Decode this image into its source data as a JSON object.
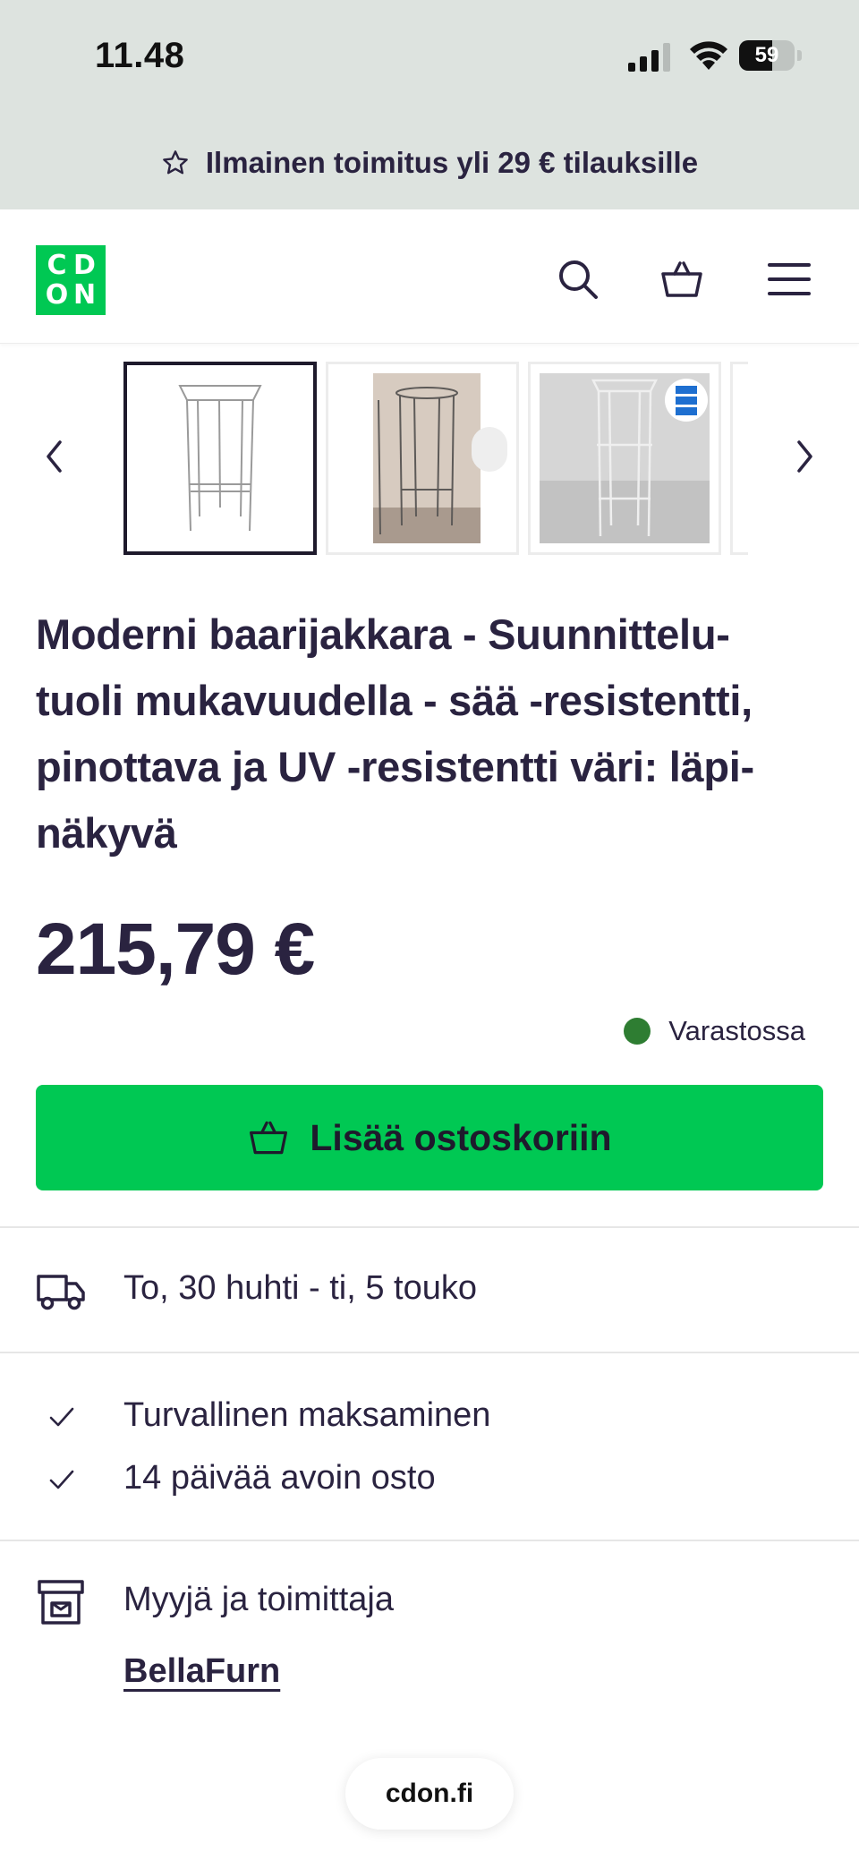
{
  "status_bar": {
    "time": "11.48",
    "battery_percent": "59",
    "battery_level": 0.59
  },
  "promo": {
    "text": "Ilmainen toimitus yli 29 € tilauksille",
    "icon": "star-outline-icon"
  },
  "header": {
    "logo_letters": [
      "C",
      "D",
      "O",
      "N"
    ],
    "logo_color": "#00c853",
    "icons": [
      "search-icon",
      "basket-icon",
      "menu-icon"
    ]
  },
  "gallery": {
    "thumbnails": [
      {
        "name": "thumbnail-1",
        "active": true
      },
      {
        "name": "thumbnail-2",
        "active": false
      },
      {
        "name": "thumbnail-3",
        "active": false
      }
    ],
    "prev_icon": "chevron-left-icon",
    "next_icon": "chevron-right-icon"
  },
  "product": {
    "title_lines": [
      "Moderni baarijakkara - Suunnittelu-",
      "tuoli mukavuudella - sää -resistentti,",
      "pinottava ja UV -resistentti väri: läpi-",
      "näkyvä"
    ],
    "price": "215,79 €",
    "stock_label": "Varastossa",
    "stock_color": "#2e7d32",
    "add_to_cart_label": "Lisää ostoskoriin",
    "cta_color": "#00c853"
  },
  "delivery": {
    "text": "To, 30 huhti - ti, 5 touko",
    "icon": "truck-icon"
  },
  "benefits": [
    {
      "text": "Turvallinen maksaminen"
    },
    {
      "text": "14 päivää avoin osto"
    }
  ],
  "seller": {
    "label": "Myyjä ja toimittaja",
    "name": "BellaFurn",
    "icon": "storefront-icon"
  },
  "browser": {
    "url": "cdon.fi"
  }
}
